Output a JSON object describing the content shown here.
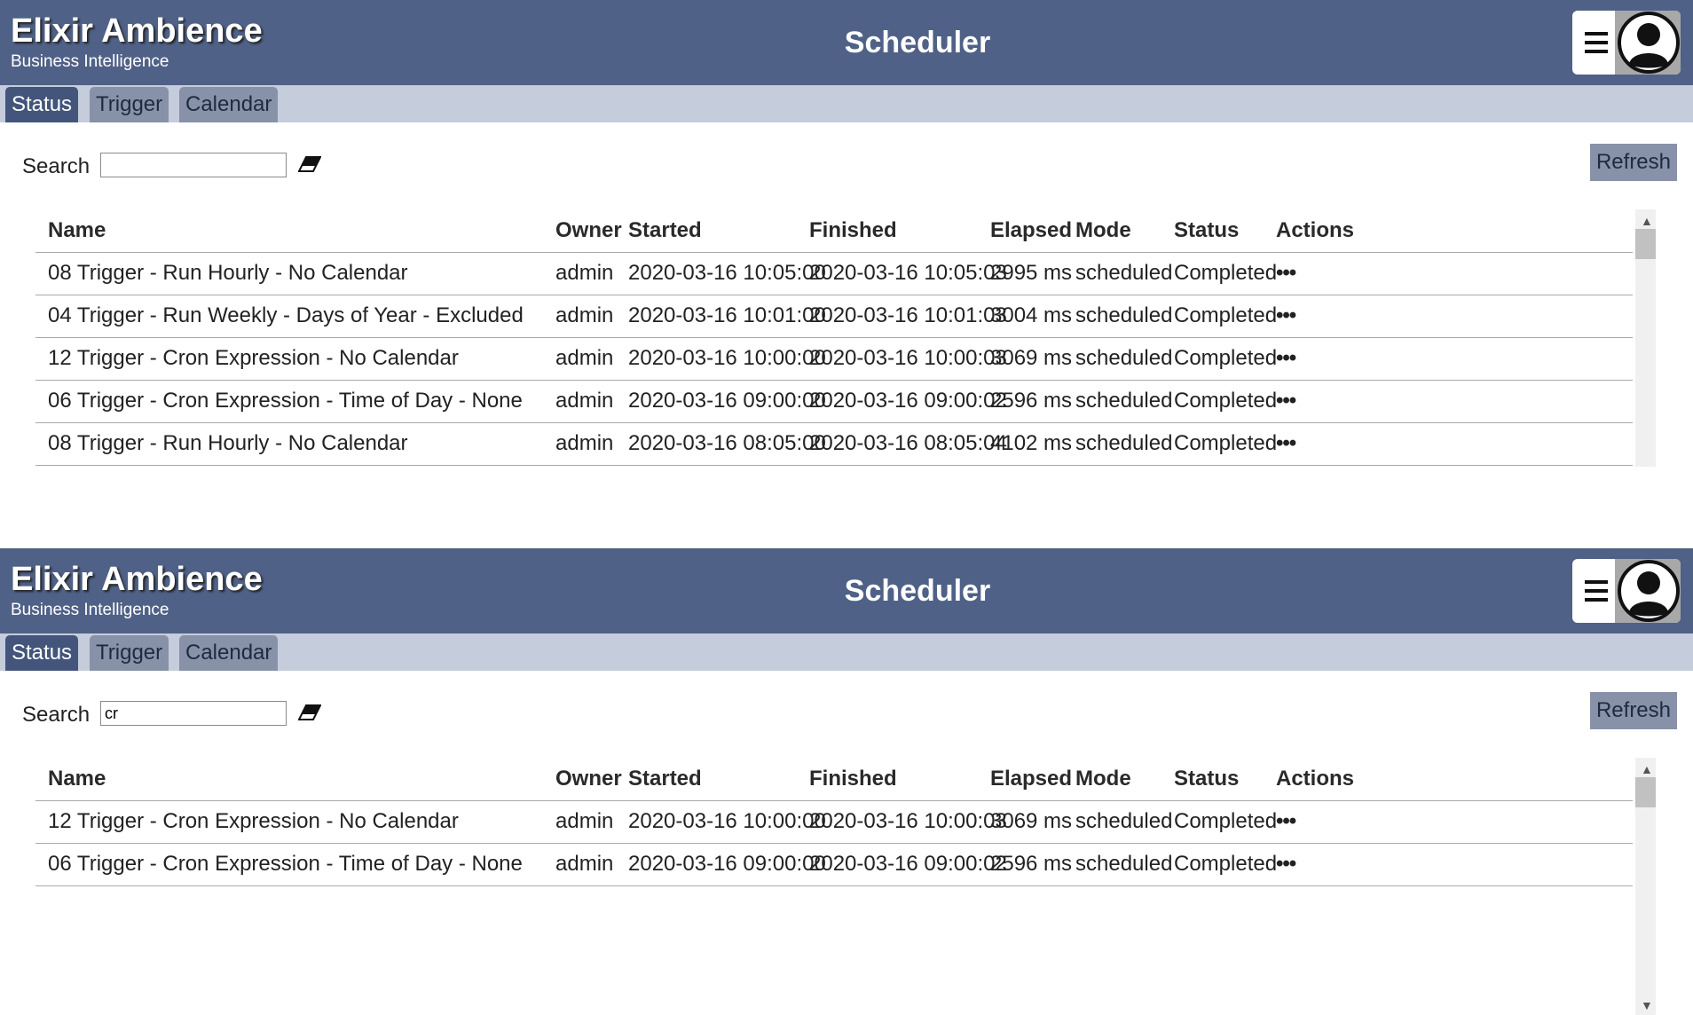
{
  "colors": {
    "header_bg": "#4f6186",
    "tabbar_bg": "#c5ccdb",
    "tab_active": "#43557b",
    "tab_inactive": "#8791a8"
  },
  "panels": [
    {
      "brand": {
        "title": "Elixir Ambience",
        "subtitle": "Business Intelligence"
      },
      "app_title": "Scheduler",
      "tabs": [
        {
          "label": "Status"
        },
        {
          "label": "Trigger"
        },
        {
          "label": "Calendar"
        }
      ],
      "search": {
        "label": "Search",
        "value": ""
      },
      "refresh_label": "Refresh",
      "columns": [
        "Name",
        "Owner",
        "Started",
        "Finished",
        "Elapsed",
        "Mode",
        "Status",
        "Actions"
      ],
      "rows": [
        [
          "08 Trigger - Run Hourly - No Calendar",
          "admin",
          "2020-03-16 10:05:00",
          "2020-03-16 10:05:03",
          "2995 ms",
          "scheduled",
          "Completed",
          "•••"
        ],
        [
          "04 Trigger - Run Weekly - Days of Year - Excluded",
          "admin",
          "2020-03-16 10:01:00",
          "2020-03-16 10:01:03",
          "3004 ms",
          "scheduled",
          "Completed",
          "•••"
        ],
        [
          "12 Trigger - Cron Expression - No Calendar",
          "admin",
          "2020-03-16 10:00:00",
          "2020-03-16 10:00:03",
          "3069 ms",
          "scheduled",
          "Completed",
          "•••"
        ],
        [
          "06 Trigger - Cron Expression - Time of Day - None",
          "admin",
          "2020-03-16 09:00:00",
          "2020-03-16 09:00:02",
          "2596 ms",
          "scheduled",
          "Completed",
          "•••"
        ],
        [
          "08 Trigger - Run Hourly - No Calendar",
          "admin",
          "2020-03-16 08:05:00",
          "2020-03-16 08:05:04",
          "4102 ms",
          "scheduled",
          "Completed",
          "•••"
        ]
      ],
      "scroll_up_icon": "▲",
      "scroll_down_icon": ""
    },
    {
      "brand": {
        "title": "Elixir Ambience",
        "subtitle": "Business Intelligence"
      },
      "app_title": "Scheduler",
      "tabs": [
        {
          "label": "Status"
        },
        {
          "label": "Trigger"
        },
        {
          "label": "Calendar"
        }
      ],
      "search": {
        "label": "Search",
        "value": "cr"
      },
      "refresh_label": "Refresh",
      "columns": [
        "Name",
        "Owner",
        "Started",
        "Finished",
        "Elapsed",
        "Mode",
        "Status",
        "Actions"
      ],
      "rows": [
        [
          "12 Trigger - Cron Expression - No Calendar",
          "admin",
          "2020-03-16 10:00:00",
          "2020-03-16 10:00:03",
          "3069 ms",
          "scheduled",
          "Completed",
          "•••"
        ],
        [
          "06 Trigger - Cron Expression - Time of Day - None",
          "admin",
          "2020-03-16 09:00:00",
          "2020-03-16 09:00:02",
          "2596 ms",
          "scheduled",
          "Completed",
          "•••"
        ]
      ],
      "scroll_up_icon": "▲",
      "scroll_down_icon": "▼"
    }
  ]
}
